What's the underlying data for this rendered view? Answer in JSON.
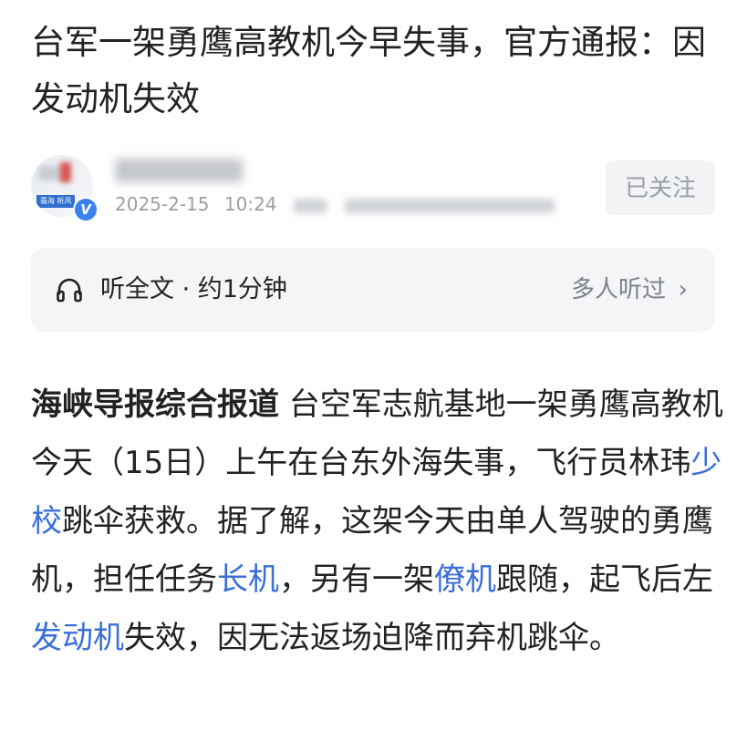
{
  "article": {
    "title": "台军一架勇鹰高教机今早失事，官方通报：因发动机失效",
    "author": {
      "avatar_logo_text": "翡海 听风",
      "verified_badge": "V",
      "date": "2025-2-15",
      "time": "10:24"
    },
    "follow_button_label": "已关注",
    "audio": {
      "icon": "headphone-icon",
      "label": "听全文 · 约1分钟",
      "listeners_label": "多人听过",
      "chevron": "›"
    },
    "body": {
      "source": "海峡导报综合报道",
      "seg1": " 台空军志航基地一架勇鹰高教机今天（15日）上午在台东外海失事，飞行员林玮",
      "link1": "少校",
      "seg2": "跳伞获救。据了解，这架今天由单人驾驶的勇鹰机，担任任务",
      "link2": "长机",
      "seg3": "，另有一架",
      "link3": "僚机",
      "seg4": "跟随，起飞后左",
      "link4": "发动机",
      "seg5": "失效，因无法返场迫降而弃机跳伞。"
    }
  },
  "colors": {
    "link": "#3a6fd8",
    "muted": "#9a9ea6",
    "panel_bg": "#f4f5f7",
    "verified": "#3b82f0"
  }
}
